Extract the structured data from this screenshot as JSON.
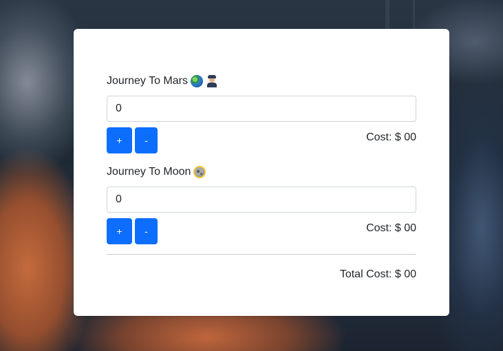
{
  "journeys": [
    {
      "title": "Journey To Mars",
      "icons": [
        "earth-globe-icon",
        "pilot-icon"
      ],
      "quantity_value": "0",
      "plus_label": "+",
      "minus_label": "-",
      "cost_label": "Cost: $ 00"
    },
    {
      "title": "Journey To Moon",
      "icons": [
        "moon-icon"
      ],
      "quantity_value": "0",
      "plus_label": "+",
      "minus_label": "-",
      "cost_label": "Cost: $ 00"
    }
  ],
  "total_label": "Total Cost: $ 00",
  "colors": {
    "primary_button": "#0d6efd",
    "card_background": "#ffffff",
    "text": "#212529",
    "input_border": "#ced4da"
  }
}
